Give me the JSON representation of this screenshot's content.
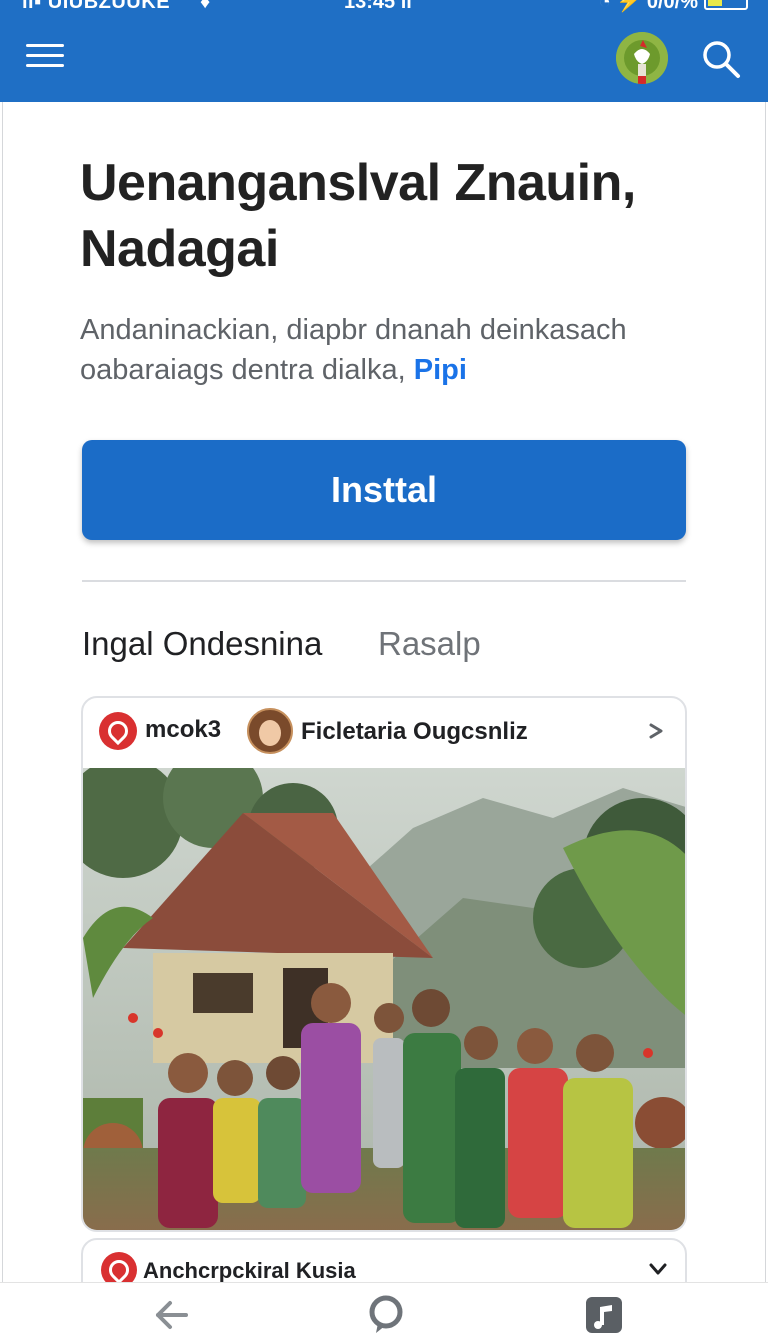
{
  "status_bar": {
    "carrier": "ıl▪ UIUBZUUKE",
    "indicator": "♦",
    "time": "13:45 ıl",
    "battery_text": "◔ ⚡ 0/0/%"
  },
  "header": {
    "menu_icon": "hamburger-menu-icon",
    "avatar_icon": "profile-avatar-icon",
    "search_icon": "search-icon"
  },
  "main": {
    "title": "Uenanganslval Znauin, Nadagai",
    "description": "Andaninackian, diapbr dnanah deinkasach oabaraiags dentra dialka,",
    "description_link": "Pipi",
    "install_label": "Insttal"
  },
  "tabs": [
    {
      "label": "Ingal Ondesnina",
      "active": true
    },
    {
      "label": "Rasalp",
      "active": false
    }
  ],
  "posts": [
    {
      "source": "mcok3",
      "author": "Ficletaria Ougcsnliz",
      "icon": "location-pin-icon",
      "image": "village-gathering-photo"
    },
    {
      "title": "Anchcrpckiral Kusia",
      "icon": "location-pin-icon"
    }
  ],
  "bottom_nav": {
    "back_icon": "back-arrow-icon",
    "home_icon": "chat-bubble-icon",
    "recent_icon": "music-app-icon"
  },
  "colors": {
    "primary": "#1f6fc5",
    "button": "#1b6cc7",
    "link": "#1a73e8",
    "pin": "#d93031"
  }
}
